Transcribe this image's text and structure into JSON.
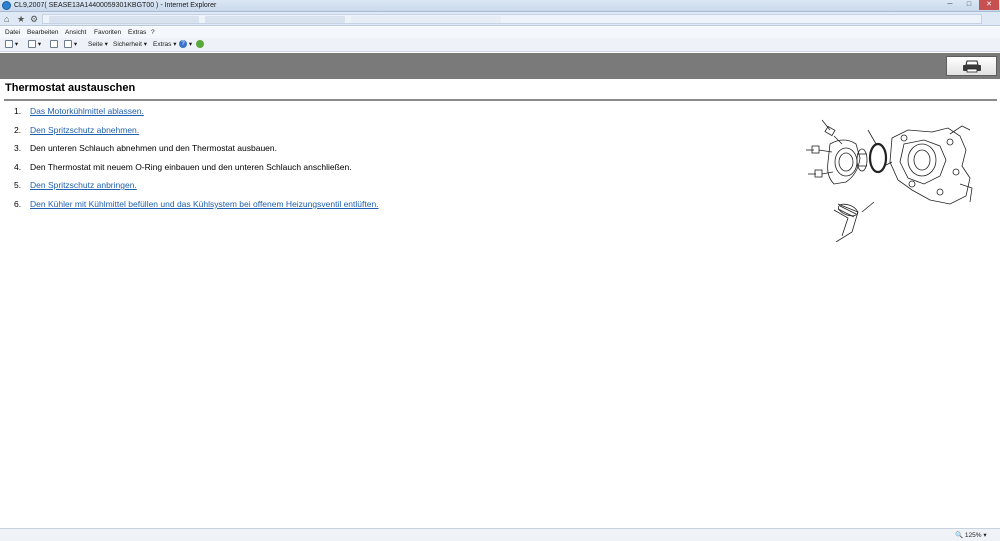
{
  "window": {
    "title": "CL9,2007( SEASE13A14400059301KBGT00 ) - Internet Explorer",
    "min_symbol": "─",
    "max_symbol": "□",
    "close_symbol": "✕"
  },
  "nav": {
    "home_icon": "⌂",
    "favorites_icon": "★",
    "settings_icon": "⚙"
  },
  "menubar": {
    "items": [
      "Datei",
      "Bearbeiten",
      "Ansicht",
      "Favoriten",
      "Extras",
      "?"
    ]
  },
  "commandbar": {
    "seite_label": "Seite",
    "sicherheit_label": "Sicherheit",
    "extras_label": "Extras",
    "dropdown_arrow": "▾",
    "help_symbol": "?"
  },
  "page": {
    "title": "Thermostat austauschen",
    "steps": [
      {
        "num": "1.",
        "text": "Das Motorkühlmittel ablassen.",
        "link": true
      },
      {
        "num": "2.",
        "text": "Den Spritzschutz abnehmen.",
        "link": true
      },
      {
        "num": "3.",
        "text": "Den unteren Schlauch abnehmen und den Thermostat ausbauen.",
        "link": false
      },
      {
        "num": "4.",
        "text": "Den Thermostat mit neuem O-Ring einbauen und den unteren Schlauch anschließen.",
        "link": false
      },
      {
        "num": "5.",
        "text": "Den Spritzschutz anbringen.",
        "link": true
      },
      {
        "num": "6.",
        "text": "Den Kühler mit Kühlmittel befüllen und das Kühlsystem bei offenem Heizungsventil entlüften.",
        "link": true
      }
    ]
  },
  "status": {
    "zoom": "125%"
  },
  "colors": {
    "link": "#1f5fb0",
    "graybar": "#7a7a7a",
    "close_button": "#c75050"
  }
}
